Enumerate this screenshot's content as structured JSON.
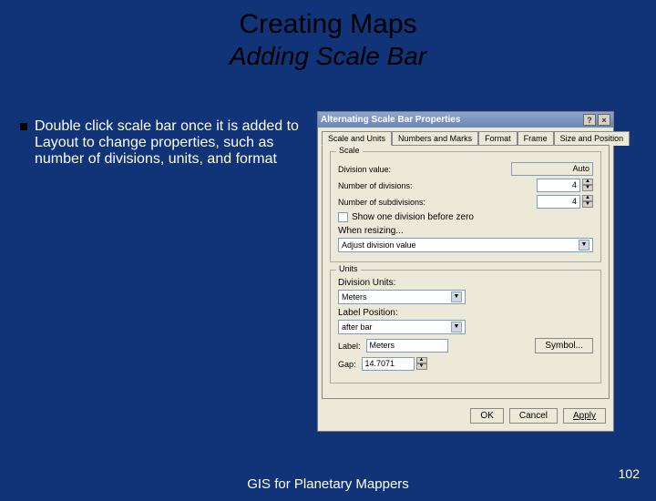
{
  "slide": {
    "title1": "Creating Maps",
    "title2": "Adding Scale Bar",
    "bullet": "Double click scale bar once it is added to Layout to change properties, such as number of divisions, units, and format",
    "footer": "GIS for Planetary Mappers",
    "page": "102"
  },
  "dialog": {
    "title": "Alternating Scale Bar Properties",
    "help": "?",
    "close": "×",
    "tabs": {
      "t1": "Scale and Units",
      "t2": "Numbers and Marks",
      "t3": "Format",
      "t4": "Frame",
      "t5": "Size and Position"
    },
    "scale": {
      "group": "Scale",
      "div_lbl": "Division value:",
      "div_val": "Auto",
      "ndiv_lbl": "Number of divisions:",
      "ndiv_val": "4",
      "nsub_lbl": "Number of subdivisions:",
      "nsub_val": "4",
      "cb_lbl": "Show one division before zero",
      "resize_lbl": "When resizing...",
      "resize_val": "Adjust division value"
    },
    "units": {
      "group": "Units",
      "du_lbl": "Division Units:",
      "du_val": "Meters",
      "lp_lbl": "Label Position:",
      "lp_val": "after bar",
      "label_lbl": "Label:",
      "label_val": "Meters",
      "symbol_btn": "Symbol...",
      "gap_lbl": "Gap:",
      "gap_val": "14.7071"
    },
    "buttons": {
      "ok": "OK",
      "cancel": "Cancel",
      "apply": "Apply"
    }
  }
}
